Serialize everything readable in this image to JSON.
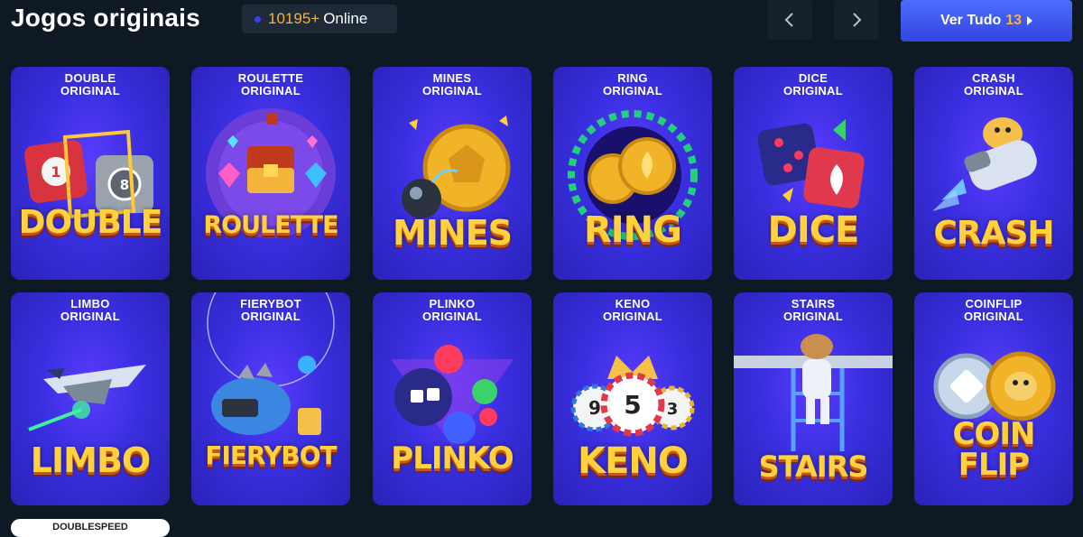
{
  "header": {
    "title": "Jogos originais",
    "online_count": "10195+",
    "online_label": "Online",
    "ver_tudo_label": "Ver Tudo",
    "ver_tudo_count": "13"
  },
  "games": [
    {
      "sub1": "DOUBLE",
      "sub2": "ORIGINAL",
      "name": "DOUBLE"
    },
    {
      "sub1": "ROULETTE",
      "sub2": "ORIGINAL",
      "name": "ROULETTE"
    },
    {
      "sub1": "MINES",
      "sub2": "ORIGINAL",
      "name": "MINES"
    },
    {
      "sub1": "RING",
      "sub2": "ORIGINAL",
      "name": "RING"
    },
    {
      "sub1": "DICE",
      "sub2": "ORIGINAL",
      "name": "DICE"
    },
    {
      "sub1": "CRASH",
      "sub2": "ORIGINAL",
      "name": "CRASH"
    },
    {
      "sub1": "LIMBO",
      "sub2": "ORIGINAL",
      "name": "LIMBO"
    },
    {
      "sub1": "FIERYBOT",
      "sub2": "ORIGINAL",
      "name": "FIERYBOT"
    },
    {
      "sub1": "PLINKO",
      "sub2": "ORIGINAL",
      "name": "PLINKO"
    },
    {
      "sub1": "KENO",
      "sub2": "ORIGINAL",
      "name": "KENO"
    },
    {
      "sub1": "STAIRS",
      "sub2": "ORIGINAL",
      "name": "STAIRS"
    },
    {
      "sub1": "COINFLIP",
      "sub2": "ORIGINAL",
      "name": "COIN FLIP"
    }
  ],
  "partial_next": "DOUBLESPEED",
  "colors": {
    "background": "#0f1923",
    "accent": "#3b5cf5",
    "gold": "#f5b43b"
  }
}
